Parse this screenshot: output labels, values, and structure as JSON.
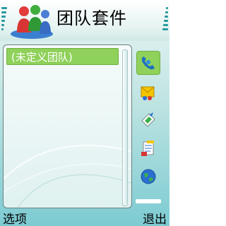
{
  "app": {
    "title": "团队套件"
  },
  "list": {
    "items": [
      {
        "label": "(未定义团队)"
      }
    ]
  },
  "toolbar": {
    "items": [
      {
        "icon": "phone-call-icon",
        "selected": true
      },
      {
        "icon": "message-icon",
        "selected": false
      },
      {
        "icon": "send-icon",
        "selected": false
      },
      {
        "icon": "notes-icon",
        "selected": false
      },
      {
        "icon": "globe-icon",
        "selected": false
      }
    ]
  },
  "softkeys": {
    "left": "选项",
    "right": "退出"
  },
  "colors": {
    "accent": "#8fd15a",
    "background": "#bfe4e2"
  }
}
